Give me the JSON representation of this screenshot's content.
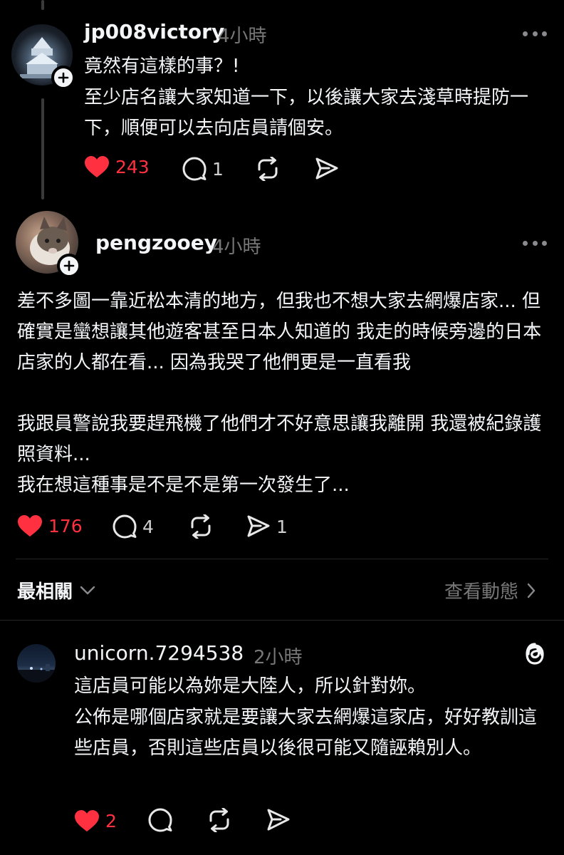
{
  "colors": {
    "background": "#000000",
    "text": "#f3f5f7",
    "muted": "#777777",
    "like": "#ff3040"
  },
  "posts": [
    {
      "username": "jp008victory",
      "time": "4小時",
      "lines": [
        "竟然有這樣的事？!",
        "至少店名讓大家知道一下，以後讓大家去淺草時提防一下，順便可以去向店員請個安。"
      ],
      "likes": "243",
      "replies": "1",
      "reposts": "",
      "shares": "",
      "liked": true
    },
    {
      "username": "pengzooey",
      "time": "4小時",
      "lines": [
        "差不多圖一靠近松本清的地方，但我也不想大家去網爆店家... 但確實是蠻想讓其他遊客甚至日本人知道的 我走的時候旁邊的日本店家的人都在看... 因為我哭了他們更是一直看我",
        "我跟員警說我要趕飛機了他們才不好意思讓我離開 我還被紀錄護照資料...",
        "我在想這種事是不是不是第一次發生了..."
      ],
      "likes": "176",
      "replies": "4",
      "reposts": "",
      "shares": "1",
      "liked": true
    }
  ],
  "section": {
    "title": "最相關",
    "view_activity": "查看動態"
  },
  "reply": {
    "username": "unicorn.7294538",
    "time": "2小時",
    "lines": [
      "這店員可能以為妳是大陸人，所以針對妳。",
      "公佈是哪個店家就是要讓大家去網爆這家店，好好教訓這些店員，否則這些店員以後很可能又隨誣賴別人。"
    ],
    "likes": "2",
    "replies": "",
    "reposts": "",
    "shares": "",
    "liked": true
  },
  "icons": {
    "like": "heart-icon",
    "reply": "comment-icon",
    "repost": "repost-icon",
    "share": "send-icon",
    "more": "more-icon",
    "follow": "plus-icon",
    "threads": "threads-logo-icon",
    "chevron_down": "chevron-down-icon",
    "chevron_right": "chevron-right-icon"
  }
}
